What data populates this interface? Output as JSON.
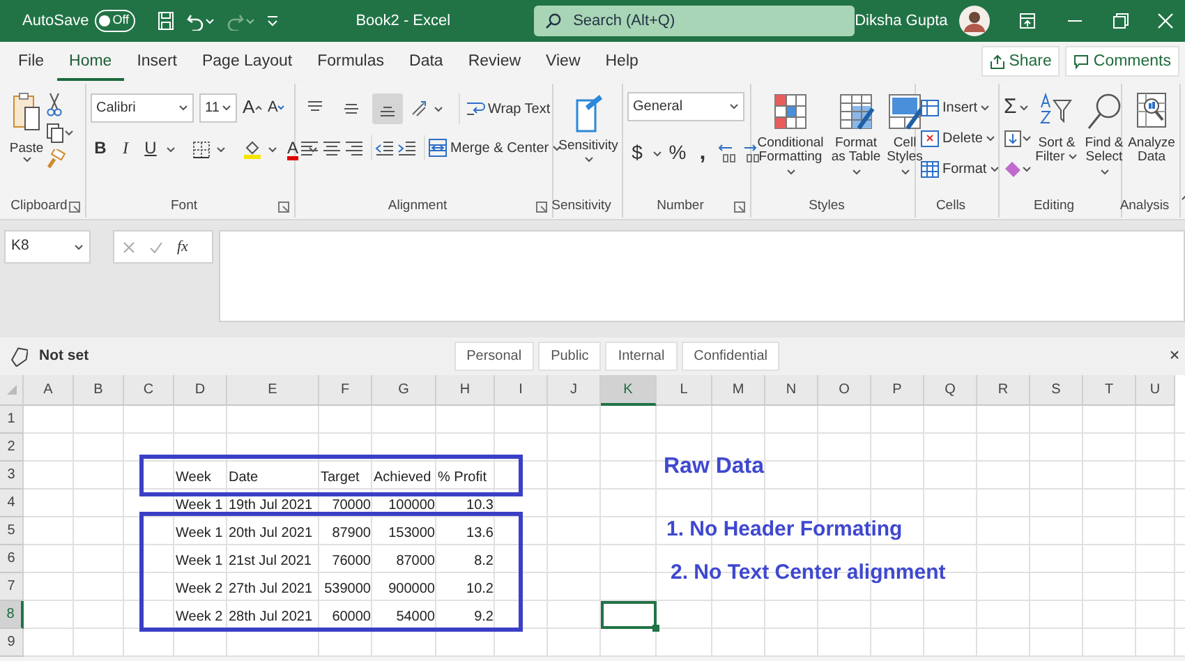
{
  "title_bar": {
    "autosave_label": "AutoSave",
    "autosave_toggle": {
      "label": "Off",
      "on": false
    },
    "redo": {
      "disabled": true
    },
    "document_title": "Book2 - Excel",
    "search": {
      "placeholder": "Search (Alt+Q)"
    },
    "user_name": "Diksha Gupta"
  },
  "tabs": [
    {
      "label": "File",
      "selected": false
    },
    {
      "label": "Home",
      "selected": true
    },
    {
      "label": "Insert",
      "selected": false
    },
    {
      "label": "Page Layout",
      "selected": false
    },
    {
      "label": "Formulas",
      "selected": false
    },
    {
      "label": "Data",
      "selected": false
    },
    {
      "label": "Review",
      "selected": false
    },
    {
      "label": "View",
      "selected": false
    },
    {
      "label": "Help",
      "selected": false
    }
  ],
  "share_button": "Share",
  "comments_button": "Comments",
  "ribbon": {
    "clipboard": {
      "label": "Clipboard",
      "launcher": true,
      "paste": "Paste"
    },
    "font": {
      "label": "Font",
      "launcher": true,
      "font_name": "Calibri",
      "font_size": "11",
      "grow": "A",
      "shrink": "A",
      "bold": "B",
      "italic": "I",
      "underline": "U",
      "font_color": "A"
    },
    "alignment": {
      "label": "Alignment",
      "launcher": true,
      "vertical_align": [
        {
          "selected": false
        },
        {
          "selected": false
        },
        {
          "selected": true
        }
      ],
      "wrap_text": "Wrap Text",
      "merge": "Merge & Center"
    },
    "sensitivity": {
      "label": "Sensitivity",
      "launcher": false,
      "button": "Sensitivity"
    },
    "number": {
      "label": "Number",
      "launcher": true,
      "format": "General",
      "currency": "$",
      "percent": "%",
      "comma": ","
    },
    "styles": {
      "label": "Styles",
      "launcher": false,
      "buttons": [
        "Conditional Formatting",
        "Format as Table",
        "Cell Styles"
      ]
    },
    "cells": {
      "label": "Cells",
      "launcher": false,
      "buttons": [
        "Insert",
        "Delete",
        "Format"
      ]
    },
    "editing": {
      "label": "Editing",
      "launcher": false,
      "autosum": "Σ",
      "sort": "Sort & Filter",
      "find": "Find & Select"
    },
    "analysis": {
      "label": "Analysis",
      "launcher": false,
      "button": "Analyze Data"
    }
  },
  "formula_bar": {
    "name_box": "K8",
    "function_label": "fx"
  },
  "sensitivity_bar": {
    "status": "Not set",
    "labels": [
      "Personal",
      "Public",
      "Internal",
      "Confidential"
    ]
  },
  "sheet": {
    "columns": [
      {
        "label": "A",
        "selected": false
      },
      {
        "label": "B",
        "selected": false
      },
      {
        "label": "C",
        "selected": false
      },
      {
        "label": "D",
        "selected": false
      },
      {
        "label": "E",
        "selected": false
      },
      {
        "label": "F",
        "selected": false
      },
      {
        "label": "G",
        "selected": false
      },
      {
        "label": "H",
        "selected": false
      },
      {
        "label": "I",
        "selected": false
      },
      {
        "label": "J",
        "selected": false
      },
      {
        "label": "K",
        "selected": true
      },
      {
        "label": "L",
        "selected": false
      },
      {
        "label": "M",
        "selected": false
      },
      {
        "label": "N",
        "selected": false
      },
      {
        "label": "O",
        "selected": false
      },
      {
        "label": "P",
        "selected": false
      },
      {
        "label": "Q",
        "selected": false
      },
      {
        "label": "R",
        "selected": false
      },
      {
        "label": "S",
        "selected": false
      },
      {
        "label": "T",
        "selected": false
      },
      {
        "label": "U",
        "selected": false
      }
    ],
    "rows": [
      {
        "label": "1",
        "selected": false
      },
      {
        "label": "2",
        "selected": false
      },
      {
        "label": "3",
        "selected": false
      },
      {
        "label": "4",
        "selected": false
      },
      {
        "label": "5",
        "selected": false
      },
      {
        "label": "6",
        "selected": false
      },
      {
        "label": "7",
        "selected": false
      },
      {
        "label": "8",
        "selected": true
      },
      {
        "label": "9",
        "selected": false
      }
    ],
    "table": {
      "columns": [
        {
          "label": "Week",
          "right_aligned": false
        },
        {
          "label": "Date",
          "right_aligned": false
        },
        {
          "label": "Target",
          "right_aligned": true
        },
        {
          "label": "Achieved",
          "right_aligned": true
        },
        {
          "label": "% Profit",
          "right_aligned": true
        }
      ],
      "rows": [
        [
          "Week 1",
          "19th Jul 2021",
          "70000",
          "100000",
          "10.3"
        ],
        [
          "Week 1",
          "20th Jul 2021",
          "87900",
          "153000",
          "13.6"
        ],
        [
          "Week 1",
          "21st Jul 2021",
          "76000",
          "87000",
          "8.2"
        ],
        [
          "Week 2",
          "27th Jul 2021",
          "539000",
          "900000",
          "10.2"
        ],
        [
          "Week 2",
          "28th Jul 2021",
          "60000",
          "54000",
          "9.2"
        ]
      ]
    },
    "annotations": [
      {
        "text": "Raw Data"
      },
      {
        "text": "1. No Header Formating"
      },
      {
        "text": "2. No Text Center alignment"
      }
    ]
  }
}
